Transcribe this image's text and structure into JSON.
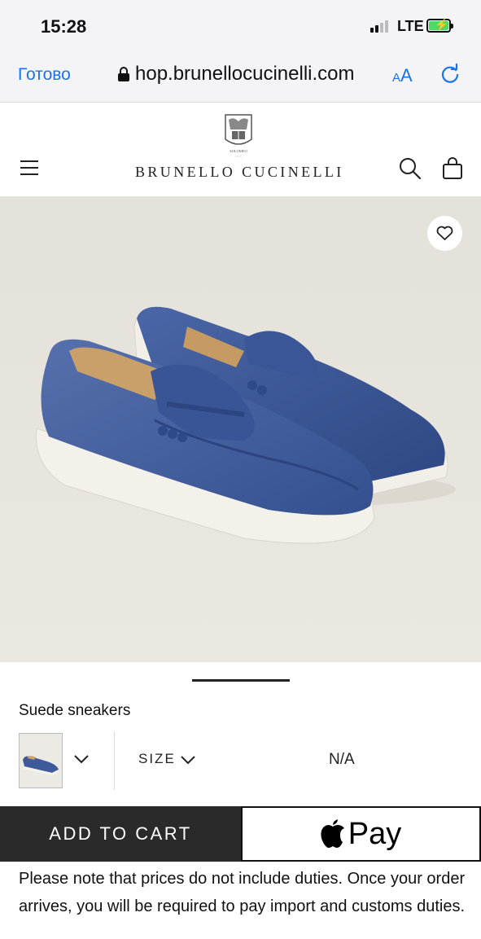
{
  "status_bar": {
    "time": "15:28",
    "network": "LTE"
  },
  "browser": {
    "done_label": "Готово",
    "url": "hop.brunellocucinelli.com",
    "text_size_label": "AA"
  },
  "header": {
    "brand": "BRUNELLO CUCINELLI",
    "crest_text": "SOLOMEO"
  },
  "product": {
    "name": "Suede sneakers",
    "size_label": "SIZE",
    "size_value": "N/A",
    "add_to_cart_label": "ADD TO CART",
    "apple_pay_label": "Pay",
    "duties_note": "Please note that prices do not include duties. Once your order arrives, you will be required to pay import and customs duties."
  },
  "colors": {
    "accent": "#1a73e8",
    "button_dark": "#2a2a2a",
    "shoe_blue": "#3f5a9a"
  },
  "icons": [
    "lock-icon",
    "reload-icon",
    "menu-icon",
    "search-icon",
    "bag-icon",
    "heart-icon",
    "chevron-down-icon",
    "apple-logo-icon"
  ]
}
